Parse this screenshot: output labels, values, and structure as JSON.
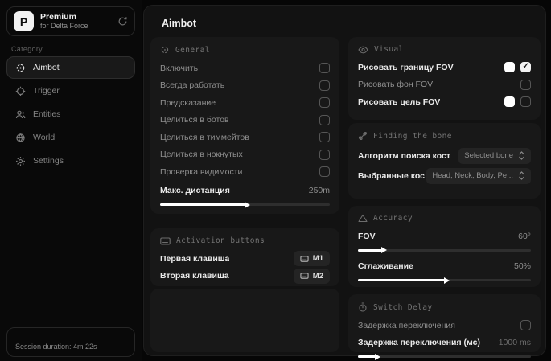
{
  "colors": {
    "accent": "#ffffff",
    "page_bg": "#060606",
    "panel_bg": "#181818",
    "swatch": "#ffffff"
  },
  "brand": {
    "logo_letter": "P",
    "title": "Premium",
    "subtitle": "for Delta Force"
  },
  "sidebar": {
    "category_label": "Category",
    "items": [
      {
        "label": "Aimbot",
        "icon": "scan-icon",
        "active": true
      },
      {
        "label": "Trigger",
        "icon": "crosshair-icon",
        "active": false
      },
      {
        "label": "Entities",
        "icon": "users-icon",
        "active": false
      },
      {
        "label": "World",
        "icon": "globe-icon",
        "active": false
      },
      {
        "label": "Settings",
        "icon": "gear-icon",
        "active": false
      }
    ],
    "session_text": "Session duration: 4m 22s"
  },
  "page": {
    "title": "Aimbot"
  },
  "general": {
    "title": "General",
    "icon": "target-icon",
    "checkboxes": [
      "Включить",
      "Всегда работать",
      "Предсказание",
      "Целиться в ботов",
      "Целиться в тиммейтов",
      "Целиться в нокнутых",
      "Проверка видимости"
    ],
    "max_distance": {
      "label": "Макс. дистанция",
      "value": "250m",
      "fill_pct": 50
    }
  },
  "activation": {
    "title": "Activation buttons",
    "icon": "keyboard-icon",
    "keys": [
      {
        "label": "Первая клавиша",
        "key": "M1"
      },
      {
        "label": "Вторая клавиша",
        "key": "M2"
      }
    ]
  },
  "visual": {
    "title": "Visual",
    "icon": "eye-icon",
    "rows": [
      {
        "label": "Рисовать границу FOV",
        "has_swatch": true,
        "checked": true
      },
      {
        "label": "Рисовать фон FOV",
        "has_swatch": false,
        "checked": false
      },
      {
        "label": "Рисовать цель FOV",
        "has_swatch": true,
        "checked": false
      }
    ]
  },
  "bone": {
    "title": "Finding the bone",
    "icon": "bone-icon",
    "rows": [
      {
        "label": "Алгоритм поиска кост",
        "value": "Selected bone"
      },
      {
        "label": "Выбранные кос",
        "value": "Head, Neck, Body, Pe..."
      }
    ]
  },
  "accuracy": {
    "title": "Accuracy",
    "icon": "triangle-icon",
    "sliders": [
      {
        "label": "FOV",
        "value": "60°",
        "fill_pct": 14
      },
      {
        "label": "Сглаживание",
        "value": "50%",
        "fill_pct": 50
      }
    ]
  },
  "switch_delay": {
    "title": "Switch Delay",
    "icon": "timer-icon",
    "toggle_label": "Задержка переключения",
    "slider": {
      "label": "Задержка переключения (мс)",
      "value": "1000 ms",
      "fill_pct": 10
    }
  }
}
